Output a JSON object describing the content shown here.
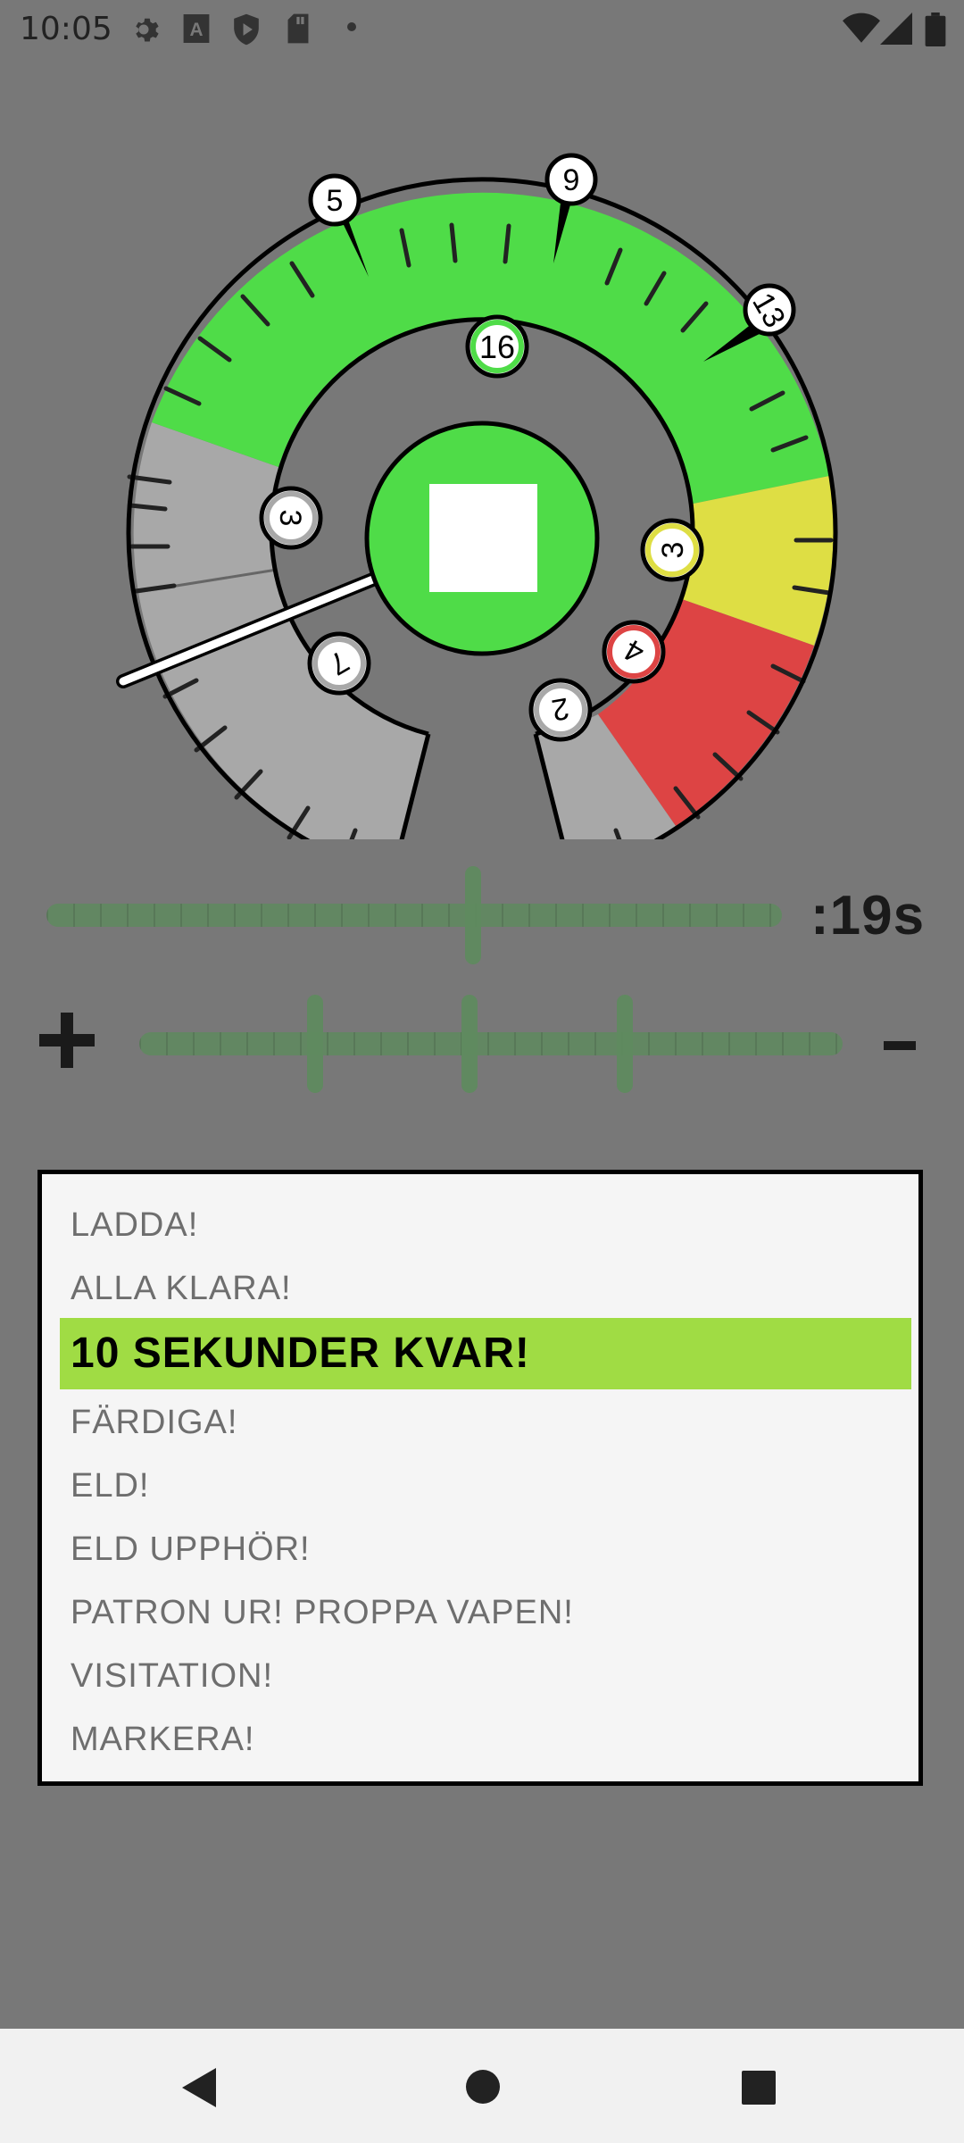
{
  "status_bar": {
    "time": "10:05",
    "left_icons": [
      "gear-icon",
      "font-icon",
      "shield-play-icon",
      "sd-card-icon",
      "dot-icon"
    ],
    "right_icons": [
      "wifi-icon",
      "signal-icon",
      "battery-icon"
    ]
  },
  "dial": {
    "markers": {
      "outer": [
        "5",
        "9",
        "13"
      ],
      "inner_green": "16",
      "inner_left_1": "3",
      "inner_left_2": "7",
      "inner_right_yellow": "3",
      "inner_right_red": "4",
      "inner_right_bottom": "2"
    },
    "center_button": "stop-button",
    "colors": {
      "green": "#4fdc48",
      "yellow": "#dede44",
      "red": "#dd4444",
      "gray": "#a8a8a8"
    }
  },
  "time_slider": {
    "time_label": ":19s",
    "thumb_position": 0.58
  },
  "adjust_slider": {
    "plus_label": "+",
    "minus_label": "-",
    "thumb_positions": [
      0.25,
      0.47,
      0.69
    ]
  },
  "command_list": {
    "items": [
      "LADDA!",
      "ALLA KLARA!",
      "10 SEKUNDER KVAR!",
      "FÄRDIGA!",
      "ELD!",
      "ELD UPPHÖR!",
      "PATRON UR! PROPPA VAPEN!",
      "VISITATION!",
      "MARKERA!"
    ],
    "active_index": 2,
    "highlight_color": "#a0dc44"
  },
  "nav_bar": {
    "buttons": [
      "back-icon",
      "home-icon",
      "recents-icon"
    ]
  }
}
